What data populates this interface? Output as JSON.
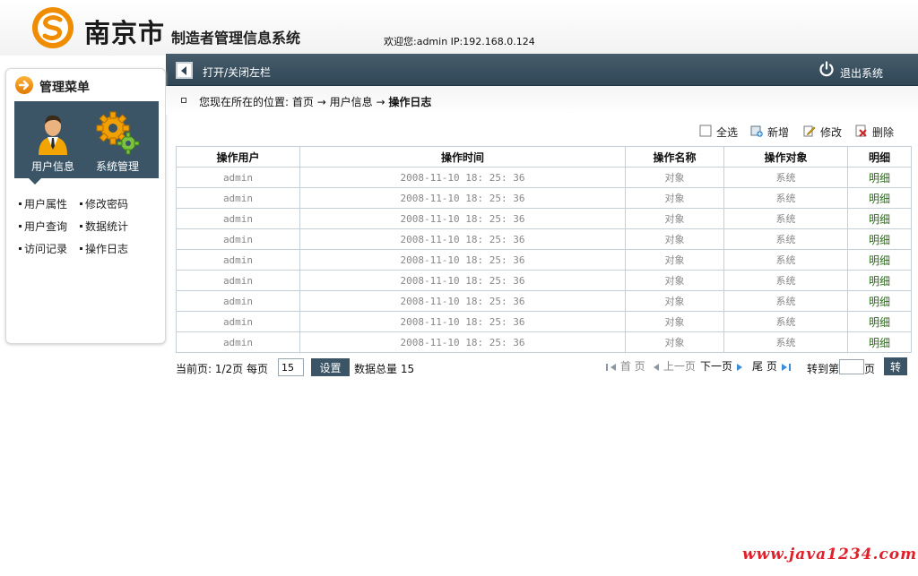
{
  "header": {
    "logo_letter": "S",
    "city": "南京市",
    "subtitle": "制造者管理信息系统",
    "welcome": "欢迎您:admin IP:192.168.0.124"
  },
  "topbar": {
    "toggle_label": "打开/关闭左栏",
    "logout_label": "退出系统"
  },
  "sidebar": {
    "title": "管理菜单",
    "panel_items": [
      {
        "label": "用户信息",
        "icon": "user-icon"
      },
      {
        "label": "系统管理",
        "icon": "gears-icon"
      }
    ],
    "links": [
      "用户属性",
      "修改密码",
      "用户查询",
      "数据统计",
      "访问记录",
      "操作日志"
    ]
  },
  "breadcrumb": {
    "prefix": "您现在所在的位置:",
    "home": "首页",
    "arrow": "→",
    "level1": "用户信息",
    "current": "操作日志"
  },
  "toolbar": {
    "select_all": "全选",
    "add": "新增",
    "edit": "修改",
    "delete": "删除"
  },
  "table": {
    "columns": [
      "操作用户",
      "操作时间",
      "操作名称",
      "操作对象",
      "明细"
    ],
    "rows": [
      [
        "admin",
        "2008-11-10 18: 25: 36",
        "对象",
        "系统",
        "明细"
      ],
      [
        "admin",
        "2008-11-10 18: 25: 36",
        "对象",
        "系统",
        "明细"
      ],
      [
        "admin",
        "2008-11-10 18: 25: 36",
        "对象",
        "系统",
        "明细"
      ],
      [
        "admin",
        "2008-11-10 18: 25: 36",
        "对象",
        "系统",
        "明细"
      ],
      [
        "admin",
        "2008-11-10 18: 25: 36",
        "对象",
        "系统",
        "明细"
      ],
      [
        "admin",
        "2008-11-10 18: 25: 36",
        "对象",
        "系统",
        "明细"
      ],
      [
        "admin",
        "2008-11-10 18: 25: 36",
        "对象",
        "系统",
        "明细"
      ],
      [
        "admin",
        "2008-11-10 18: 25: 36",
        "对象",
        "系统",
        "明细"
      ],
      [
        "admin",
        "2008-11-10 18: 25: 36",
        "对象",
        "系统",
        "明细"
      ]
    ]
  },
  "pager": {
    "current_page_label": "当前页: 1/2页 每页",
    "per_page_value": "15",
    "set_button": "设置",
    "total_label": "数据总量 15",
    "first": "首 页",
    "prev": "上一页",
    "next": "下一页",
    "last": "尾 页",
    "goto_label": "转到第",
    "goto_suffix": "页",
    "go_button": "转"
  },
  "watermark": "www.java1234.com",
  "colors": {
    "nav_dark": "#3b5566",
    "accent_orange": "#f08c00",
    "detail_green": "#2d6b1e",
    "watermark_red": "#e0202a"
  }
}
